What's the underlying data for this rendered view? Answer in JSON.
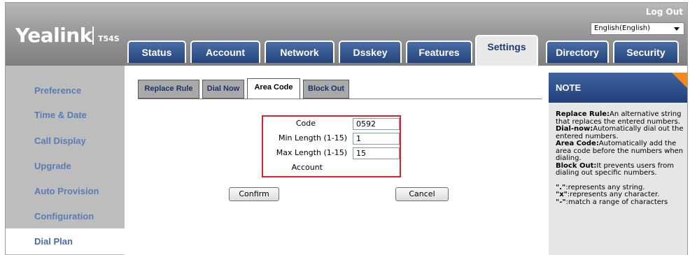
{
  "header": {
    "logo": "Yealink",
    "model": "T54S",
    "logout": "Log Out",
    "language": "English(English)"
  },
  "tabs": [
    {
      "label": "Status",
      "active": false
    },
    {
      "label": "Account",
      "active": false
    },
    {
      "label": "Network",
      "active": false
    },
    {
      "label": "Dsskey",
      "active": false
    },
    {
      "label": "Features",
      "active": false
    },
    {
      "label": "Settings",
      "active": true
    },
    {
      "label": "Directory",
      "active": false
    },
    {
      "label": "Security",
      "active": false
    }
  ],
  "sidebar": {
    "items": [
      {
        "label": "Preference"
      },
      {
        "label": "Time & Date"
      },
      {
        "label": "Call Display"
      },
      {
        "label": "Upgrade"
      },
      {
        "label": "Auto Provision"
      },
      {
        "label": "Configuration"
      },
      {
        "label": "Dial Plan",
        "active": true
      }
    ]
  },
  "subtabs": [
    {
      "label": "Replace Rule"
    },
    {
      "label": "Dial Now"
    },
    {
      "label": "Area Code",
      "active": true
    },
    {
      "label": "Block Out"
    }
  ],
  "form": {
    "code_label": "Code",
    "code_value": "0592",
    "min_label": "Min Length (1-15)",
    "min_value": "1",
    "max_label": "Max Length (1-15)",
    "max_value": "15",
    "account_label": "Account",
    "account_value": ""
  },
  "buttons": {
    "confirm": "Confirm",
    "cancel": "Cancel"
  },
  "note": {
    "title": "NOTE",
    "replace_term": "Replace Rule:",
    "replace_desc": "An alternative string that replaces the entered numbers.",
    "dialnow_term": "Dial-now:",
    "dialnow_desc": "Automatically dial out the entered numbers.",
    "areacode_term": "Area Code:",
    "areacode_desc": "Automatically add the area code before the numbers when dialing.",
    "blockout_term": "Block Out:",
    "blockout_desc": "It prevents users from dialing out specific numbers.",
    "dot_term": "\".\"",
    "dot_desc": ":represents any string.",
    "x_term": "\"x\"",
    "x_desc": ":represents any character.",
    "range_term": "\"-\"",
    "range_desc": ":match a range of characters"
  },
  "colors": {
    "tab_blue": "#24427a",
    "sidebar_text": "#5a7bb5",
    "highlight_red": "#e0202a",
    "note_corner": "#f08a1d"
  }
}
